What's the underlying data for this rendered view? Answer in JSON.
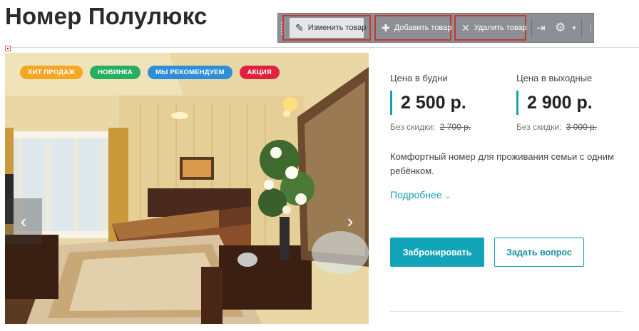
{
  "page": {
    "title": "Номер Полулюкс"
  },
  "toolbar": {
    "edit_label": "Изменить товар",
    "add_label": "Добавить товар",
    "delete_label": "Удалить товар",
    "icons": [
      "pencil-icon",
      "plus-icon",
      "close-icon",
      "pin-icon",
      "gear-icon",
      "chevron-down-icon",
      "more-icon"
    ]
  },
  "gallery": {
    "badges": [
      {
        "label": "ХИТ ПРОДАЖ",
        "color": "#f5a623"
      },
      {
        "label": "НОВИНКА",
        "color": "#27ae60"
      },
      {
        "label": "МЫ РЕКОМЕНДУЕМ",
        "color": "#2e8fd6"
      },
      {
        "label": "АКЦИЯ",
        "color": "#e0223f"
      }
    ]
  },
  "prices": {
    "weekday": {
      "label": "Цена в будни",
      "value": "2 500 р.",
      "nodisc_label": "Без скидки:",
      "nodisc_value": "2 700 р."
    },
    "weekend": {
      "label": "Цена в выходные",
      "value": "2 900 р.",
      "nodisc_label": "Без скидки:",
      "nodisc_value": "3 000 р."
    }
  },
  "description": "Комфортный номер для проживания семьи с одним ребёнком.",
  "more_link": "Подробнее",
  "actions": {
    "book_label": "Забронировать",
    "ask_label": "Задать вопрос"
  },
  "colors": {
    "accent": "#12a4b8",
    "toolbar_bg": "#8c9096",
    "highlight": "#c0392b"
  }
}
